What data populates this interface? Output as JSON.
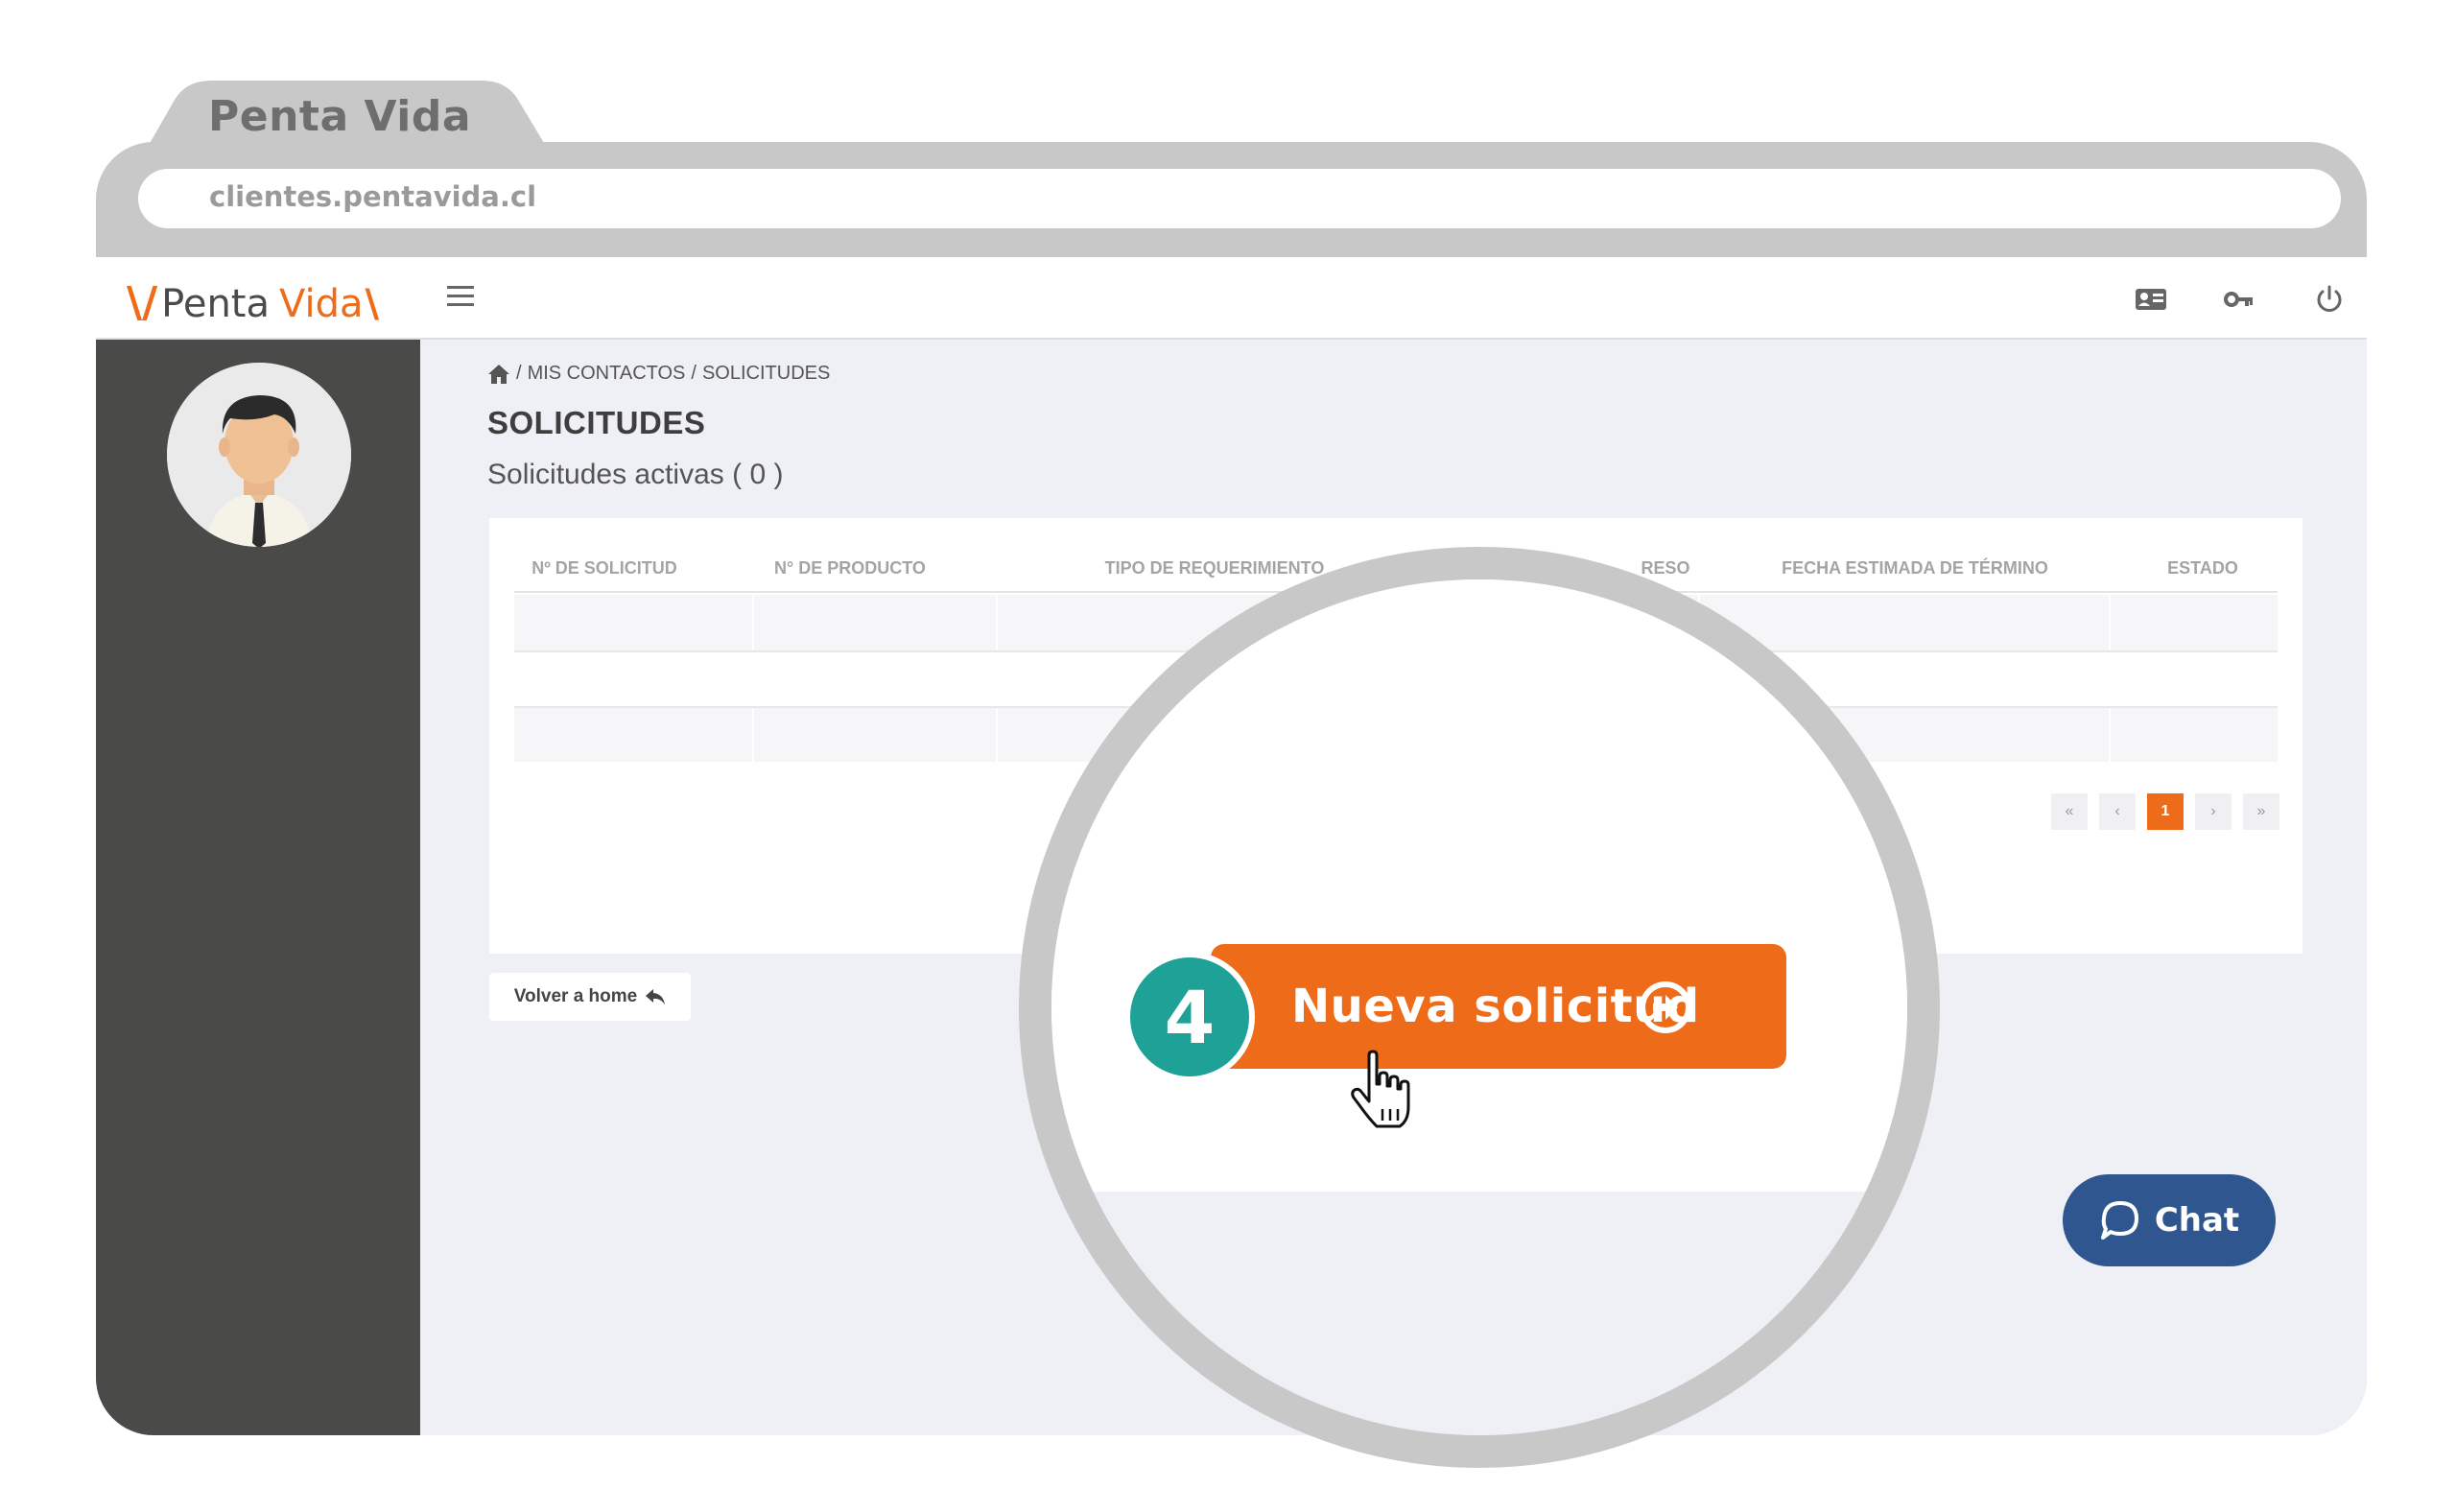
{
  "browser": {
    "tab_title": "Penta Vida",
    "url": "clientes.pentavida.cl"
  },
  "app": {
    "logo_part1": "Penta",
    "logo_part2": "Vida",
    "brand_color": "#ee6b1a",
    "breadcrumb": [
      "MIS CONTACTOS",
      "SOLICITUDES"
    ],
    "page_title": "SOLICITUDES",
    "subtitle": "Solicitudes activas ( 0 )"
  },
  "table": {
    "columns": [
      "Nº DE SOLICITUD",
      "N° DE PRODUCTO",
      "TIPO DE REQUERIMIENTO",
      "RESO",
      "FECHA ESTIMADA DE TÉRMINO",
      "ESTADO"
    ]
  },
  "pagination": {
    "first": "«",
    "prev": "‹",
    "current": "1",
    "next": "›",
    "last": "»"
  },
  "home_button": {
    "label": "Volver a home"
  },
  "callout": {
    "step": "4",
    "button_label": "Nueva solicitud",
    "step_color": "#1ea196"
  },
  "chat": {
    "label": "Chat",
    "color": "#2f568f"
  }
}
